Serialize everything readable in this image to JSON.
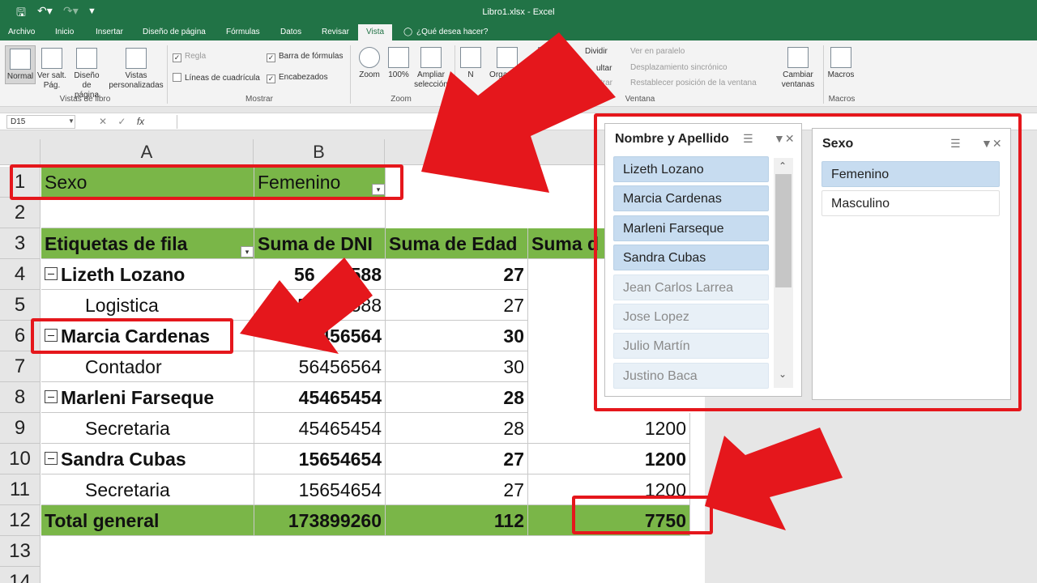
{
  "window": {
    "title": "Libro1.xlsx - Excel"
  },
  "tabs": [
    "Archivo",
    "Inicio",
    "Insertar",
    "Diseño de página",
    "Fórmulas",
    "Datos",
    "Revisar",
    "Vista",
    "¿Qué desea hacer?"
  ],
  "ribbon": {
    "vistas": {
      "group": "Vistas de libro",
      "normal": "Normal",
      "saltos": "Ver salt. Pág.",
      "diseno": "Diseño de página",
      "personalizadas": "Vistas personalizadas"
    },
    "mostrar": {
      "group": "Mostrar",
      "regla": "Regla",
      "barra": "Barra de fórmulas",
      "lineas": "Líneas de cuadrícula",
      "encabezados": "Encabezados"
    },
    "zoom": {
      "group": "Zoom",
      "zoom": "Zoom",
      "cien": "100%",
      "ampliar": "Ampliar selección"
    },
    "ventana": {
      "group": "Ventana",
      "n": "N",
      "organizar": "Organizar t",
      "dividir": "Dividir",
      "ocultar": "ultar",
      "mostrar": "strar",
      "paralelo": "Ver en paralelo",
      "desplazamiento": "Desplazamiento sincrónico",
      "restablecer": "Restablecer posición de la ventana",
      "cambiar": "Cambiar ventanas"
    },
    "macros": {
      "group": "Macros",
      "label": "Macros"
    }
  },
  "formula": {
    "namebox": "D15",
    "fx": "fx"
  },
  "columns": [
    "A",
    "B"
  ],
  "rows": [
    "1",
    "2",
    "3",
    "4",
    "5",
    "6",
    "7",
    "8",
    "9",
    "10",
    "11",
    "12",
    "13",
    "14"
  ],
  "pivot": {
    "filter_label": "Sexo",
    "filter_value": "Femenino",
    "headers": [
      "Etiquetas de fila",
      "Suma de DNI",
      "Suma de Edad",
      "Suma d"
    ],
    "r4": [
      "Lizeth Lozano",
      "56",
      "588",
      "27"
    ],
    "r5": [
      "Logistica",
      "5",
      "2588",
      "27"
    ],
    "r6": [
      "Marcia Cardenas",
      "56456564",
      "30"
    ],
    "r7": [
      "Contador",
      "56456564",
      "30"
    ],
    "r8": [
      "Marleni Farseque",
      "45465454",
      "28"
    ],
    "r9": [
      "Secretaria",
      "45465454",
      "28",
      "1200"
    ],
    "r10": [
      "Sandra Cubas",
      "15654654",
      "27",
      "1200"
    ],
    "r11": [
      "Secretaria",
      "15654654",
      "27",
      "1200"
    ],
    "total": [
      "Total general",
      "173899260",
      "112",
      "7750"
    ]
  },
  "slicer_names": {
    "title": "Nombre y Apellido",
    "items": [
      {
        "label": "Lizeth Lozano",
        "selected": true
      },
      {
        "label": "Marcia Cardenas",
        "selected": true
      },
      {
        "label": "Marleni Farseque",
        "selected": true
      },
      {
        "label": "Sandra Cubas",
        "selected": true
      },
      {
        "label": "Jean Carlos Larrea",
        "selected": false
      },
      {
        "label": "Jose Lopez",
        "selected": false
      },
      {
        "label": "Julio Martín",
        "selected": false
      },
      {
        "label": "Justino Baca",
        "selected": false
      }
    ]
  },
  "slicer_sexo": {
    "title": "Sexo",
    "items": [
      {
        "label": "Femenino",
        "selected": true
      },
      {
        "label": "Masculino",
        "selected": false
      }
    ]
  },
  "colors": {
    "excel_green": "#217346",
    "pivot_green": "#7ab648",
    "highlight_red": "#e5171c",
    "slicer_selected": "#c7dcf0"
  }
}
